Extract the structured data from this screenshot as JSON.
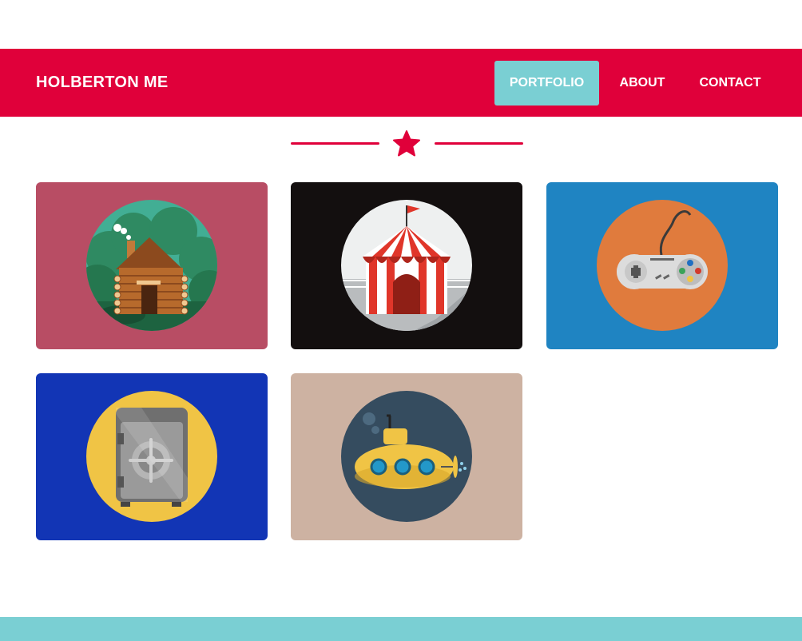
{
  "header": {
    "brand": "HOLBERTON ME",
    "nav": [
      {
        "label": "PORTFOLIO",
        "active": true
      },
      {
        "label": "ABOUT",
        "active": false
      },
      {
        "label": "CONTACT",
        "active": false
      }
    ]
  },
  "colors": {
    "primary": "#e0003a",
    "accent": "#7acfd3"
  },
  "divider": {
    "icon": "star-icon"
  },
  "portfolio": {
    "items": [
      {
        "icon": "log-cabin-icon",
        "background": "#b84d64",
        "circle": "#42ae94"
      },
      {
        "icon": "circus-tent-icon",
        "background": "#130f0f",
        "circle": "#eef0f0"
      },
      {
        "icon": "game-controller-icon",
        "background": "#1f84c2",
        "circle": "#e07b3d"
      },
      {
        "icon": "safe-icon",
        "background": "#1235b5",
        "circle": "#f0c445"
      },
      {
        "icon": "submarine-icon",
        "background": "#cdb2a2",
        "circle": "#354c5f"
      }
    ]
  }
}
